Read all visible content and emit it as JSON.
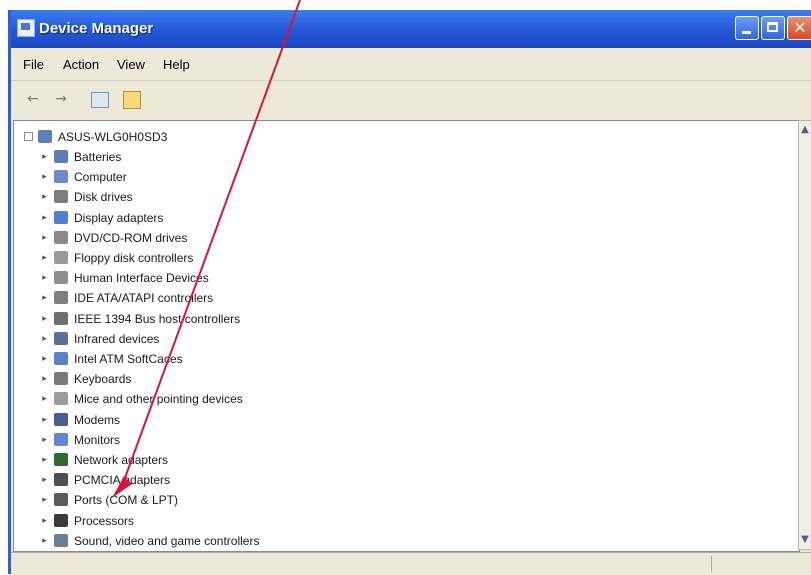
{
  "window": {
    "title": "Device Manager"
  },
  "titlebar": {
    "close_glyph": "✕"
  },
  "menu": [
    "File",
    "Action",
    "View",
    "Help"
  ],
  "toolbar": {
    "back_glyph": "←",
    "forward_glyph": "→"
  },
  "tree": {
    "root": "ASUS-WLG0H0SD3",
    "items": [
      {
        "label": "Batteries",
        "icon": "battery-icon",
        "color": "#5a7fb5"
      },
      {
        "label": "Computer",
        "icon": "computer-icon",
        "color": "#6b8cc9"
      },
      {
        "label": "Disk drives",
        "icon": "disk-drive-icon",
        "color": "#7d7d7d"
      },
      {
        "label": "Display adapters",
        "icon": "display-adapter-icon",
        "color": "#4f7fd0"
      },
      {
        "label": "DVD/CD-ROM drives",
        "icon": "dvd-drive-icon",
        "color": "#8a8a8a"
      },
      {
        "label": "Floppy disk controllers",
        "icon": "floppy-controller-icon",
        "color": "#9a9a9a"
      },
      {
        "label": "Human Interface Devices",
        "icon": "hid-icon",
        "color": "#8d8d8d"
      },
      {
        "label": "IDE ATA/ATAPI controllers",
        "icon": "ide-controller-icon",
        "color": "#7f7f7f"
      },
      {
        "label": "IEEE 1394 Bus host controllers",
        "icon": "ieee1394-icon",
        "color": "#6e6e6e"
      },
      {
        "label": "Infrared devices",
        "icon": "infrared-icon",
        "color": "#5a6e9a"
      },
      {
        "label": "Intel ATM SoftCaces",
        "icon": "intel-atm-icon",
        "color": "#5a80c8"
      },
      {
        "label": "Keyboards",
        "icon": "keyboard-icon",
        "color": "#7a7a7a"
      },
      {
        "label": "Mice and other pointing devices",
        "icon": "mouse-icon",
        "color": "#9c9c9c"
      },
      {
        "label": "Modems",
        "icon": "modem-icon",
        "color": "#4a5f90"
      },
      {
        "label": "Monitors",
        "icon": "monitor-icon",
        "color": "#5f88d0"
      },
      {
        "label": "Network adapters",
        "icon": "network-adapter-icon",
        "color": "#2f6b2f"
      },
      {
        "label": "PCMCIA adapters",
        "icon": "pcmcia-icon",
        "color": "#4f4f4f"
      },
      {
        "label": "Ports (COM & LPT)",
        "icon": "port-icon",
        "color": "#5a5a5a"
      },
      {
        "label": "Processors",
        "icon": "processor-icon",
        "color": "#3a3a3a"
      },
      {
        "label": "Sound, video and game controllers",
        "icon": "sound-controller-icon",
        "color": "#6a7f9a"
      }
    ]
  },
  "colors": {
    "annotation_arrow": "#d8143a"
  }
}
